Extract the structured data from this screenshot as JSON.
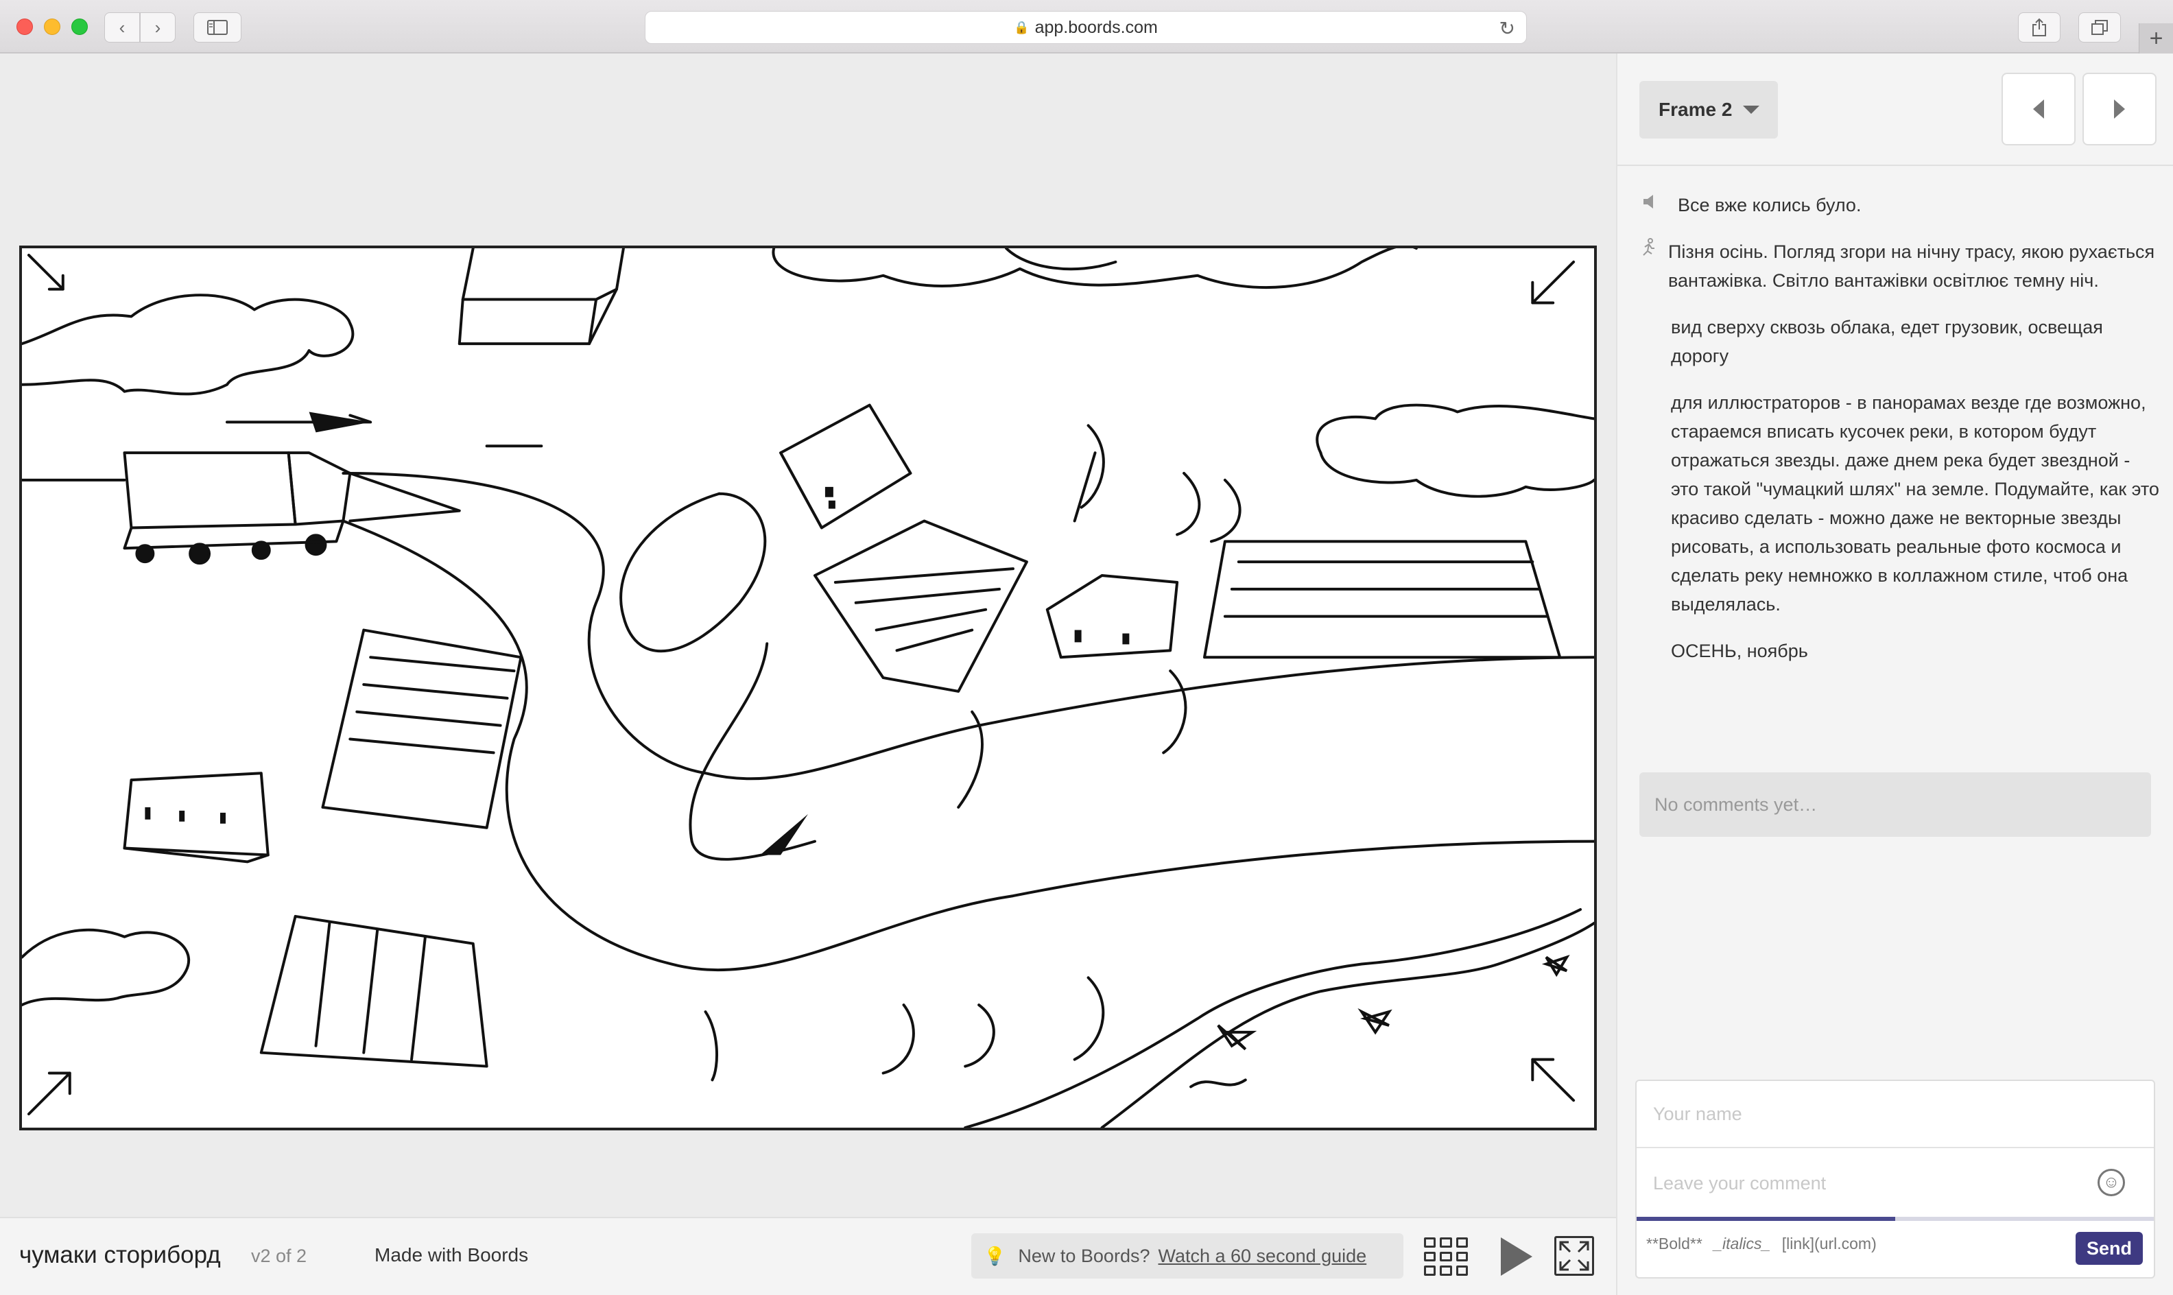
{
  "browser": {
    "url": "app.boords.com"
  },
  "frame_panel": {
    "frame_label": "Frame 2",
    "notes": [
      {
        "icon": "speaker-icon",
        "text": "Все вже колись було."
      },
      {
        "icon": "action-icon",
        "text": "Пізня осінь. Погляд згори на нічну трасу, якою рухається вантажівка. Світло вантажівки освітлює темну ніч."
      },
      {
        "icon": "",
        "text": "вид сверху сквозь облака, едет грузовик, освещая дорогу"
      },
      {
        "icon": "",
        "text": "для иллюстраторов - в панорамах везде где возможно, стараемся вписать кусочек реки, в котором будут отражаться звезды. даже днем река будет звездной - это такой \"чумацкий шлях\" на земле. Подумайте, как это красиво сделать - можно даже не векторные звезды рисовать, а использовать реальные фото космоса и сделать реку немножко в коллажном стиле, чтоб она выделялась."
      },
      {
        "icon": "",
        "text": "ОСЕНЬ, ноябрь"
      }
    ],
    "no_comments": "No comments yet…"
  },
  "comment_form": {
    "name_placeholder": "Your name",
    "comment_placeholder": "Leave your comment",
    "format_bold": "**Bold**",
    "format_italics": "_italics_",
    "format_link": "[link](url.com)",
    "send_label": "Send",
    "progress_fraction": 0.5
  },
  "bottom_bar": {
    "project_title": "чумаки сториборд",
    "version": "v2 of 2",
    "made_with": "Made with Boords",
    "guide_prefix": "New to Boords?",
    "guide_link": "Watch a 60 second guide"
  },
  "colors": {
    "send_button": "#3e3a82",
    "progress": "#4a4a8f"
  }
}
